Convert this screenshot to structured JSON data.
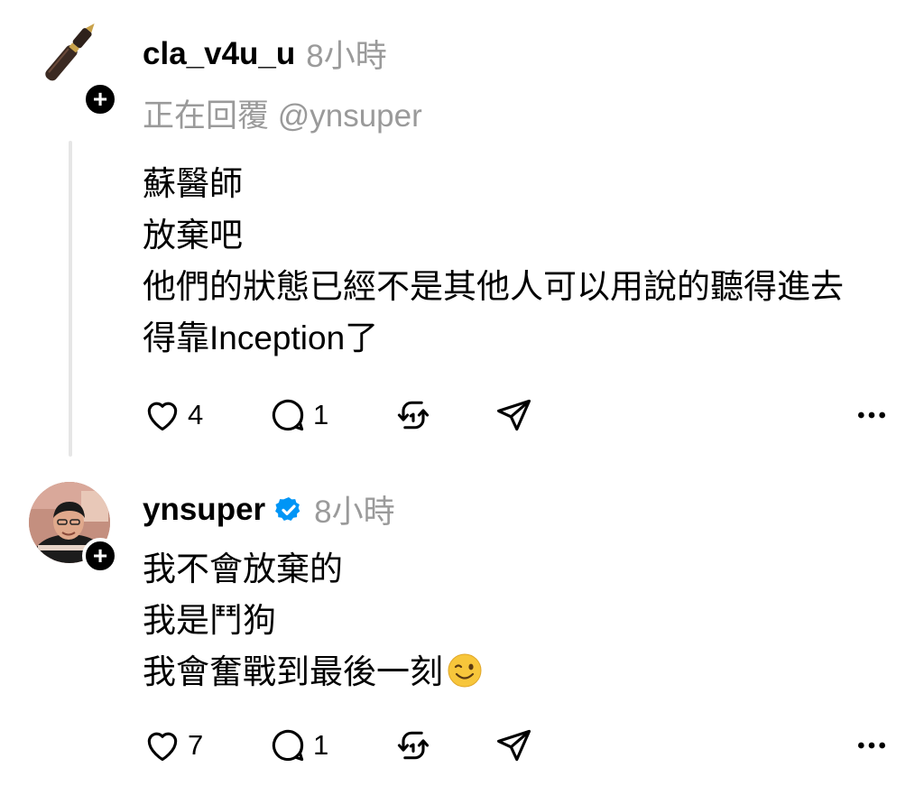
{
  "posts": [
    {
      "username": "cla_v4u_u",
      "time": "8小時",
      "reply_to": "正在回覆 @ynsuper",
      "avatar_icon": "fountain-pen",
      "lines": [
        "蘇醫師",
        "放棄吧",
        "他們的狀態已經不是其他人可以用說的聽得進去",
        "得靠Inception了"
      ],
      "likes": "4",
      "replies": "1"
    },
    {
      "username": "ynsuper",
      "verified": true,
      "verified_color": "#0095f6",
      "time": "8小時",
      "avatar_icon": "profile-photo",
      "lines": [
        "我不會放棄的",
        "我是鬥狗",
        "我會奮戰到最後一刻"
      ],
      "trailing_emoji": "winking-face",
      "likes": "7",
      "replies": "1"
    }
  ],
  "icons": {
    "like": "heart-icon",
    "reply": "speech-bubble-icon",
    "repost": "repost-icon",
    "share": "paper-plane-icon",
    "more": "more-dots-icon",
    "follow": "plus-icon"
  }
}
